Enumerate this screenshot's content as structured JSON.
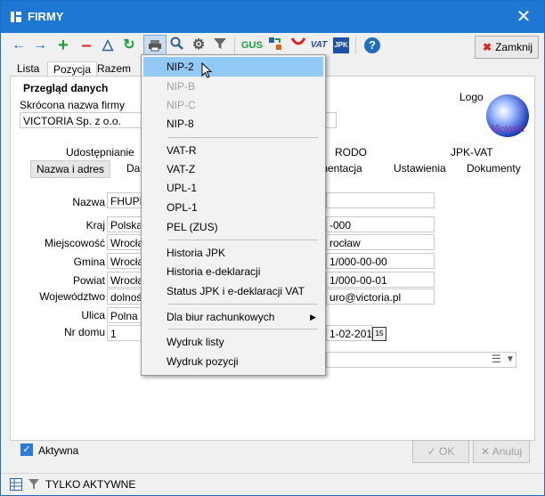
{
  "window": {
    "title": "FIRMY",
    "close_symbol": "✕"
  },
  "toolbar": {
    "close_label": "Zamknij",
    "icons": [
      "arrow-left-icon",
      "arrow-right-icon",
      "add-icon",
      "remove-icon",
      "triangle-icon",
      "refresh-icon",
      "print-icon",
      "search-icon",
      "settings-icon",
      "filter-icon",
      "gus-icon",
      "import-icon",
      "vat-icon",
      "jpk-icon",
      "help-icon"
    ],
    "vat_text": "VAT",
    "jpk_text": "JPK",
    "gus_text": "GUS"
  },
  "tabs": [
    "Lista",
    "Pozycja",
    "Razem"
  ],
  "panel": {
    "section_title": "Przegląd danych",
    "short_name_label": "Skrócona nazwa firmy",
    "short_name_value": "VICTORIA Sp. z o.o.",
    "logo_label": "Logo",
    "logo_text": "Victoria"
  },
  "subtabs_row1": [
    "Udostępnianie",
    "RODO",
    "JPK-VAT"
  ],
  "subtabs_row2": [
    "Nazwa i adres",
    "Da",
    "mentacja",
    "Ustawienia",
    "Dokumenty"
  ],
  "form": {
    "labels": [
      "Nazwa",
      "Kraj",
      "Miejscowość",
      "Gmina",
      "Powiat",
      "Województwo",
      "Ulica",
      "Nr domu"
    ],
    "left_values": [
      "FHUPR",
      "Polska",
      "Wrocław",
      "Wrocław",
      "Wrocław",
      "dolnośl",
      "Polna",
      "1"
    ],
    "right_values": [
      "-000",
      "rocław",
      "1/000-00-00",
      "1/000-00-01",
      "uro@victoria.pl"
    ],
    "date_value": "1-02-2015",
    "date_icon_text": "15"
  },
  "menu": {
    "items": [
      {
        "label": "NIP-2",
        "state": "selected"
      },
      {
        "label": "NIP-B",
        "state": "disabled"
      },
      {
        "label": "NIP-C",
        "state": "disabled"
      },
      {
        "label": "NIP-8",
        "state": "normal"
      },
      {
        "label": "VAT-R",
        "state": "normal"
      },
      {
        "label": "VAT-Z",
        "state": "normal"
      },
      {
        "label": "UPL-1",
        "state": "normal"
      },
      {
        "label": "OPL-1",
        "state": "normal"
      },
      {
        "label": "PEL (ZUS)",
        "state": "normal"
      },
      {
        "label": "Historia JPK",
        "state": "normal"
      },
      {
        "label": "Historia e-deklaracji",
        "state": "normal"
      },
      {
        "label": "Status JPK i e-deklaracji VAT",
        "state": "normal"
      },
      {
        "label": "Dla biur rachunkowych",
        "state": "submenu"
      },
      {
        "label": "Wydruk listy",
        "state": "normal"
      },
      {
        "label": "Wydruk pozycji",
        "state": "normal"
      }
    ],
    "submenu_arrow": "▶"
  },
  "footer": {
    "active_label": "Aktywna",
    "ok_label": "OK",
    "cancel_label": "Anuluj",
    "status_text": "TYLKO AKTYWNE"
  },
  "colors": {
    "titlebar": "#1e77d2",
    "menu_selected": "#91c9f7",
    "accent": "#2a7ad6"
  }
}
